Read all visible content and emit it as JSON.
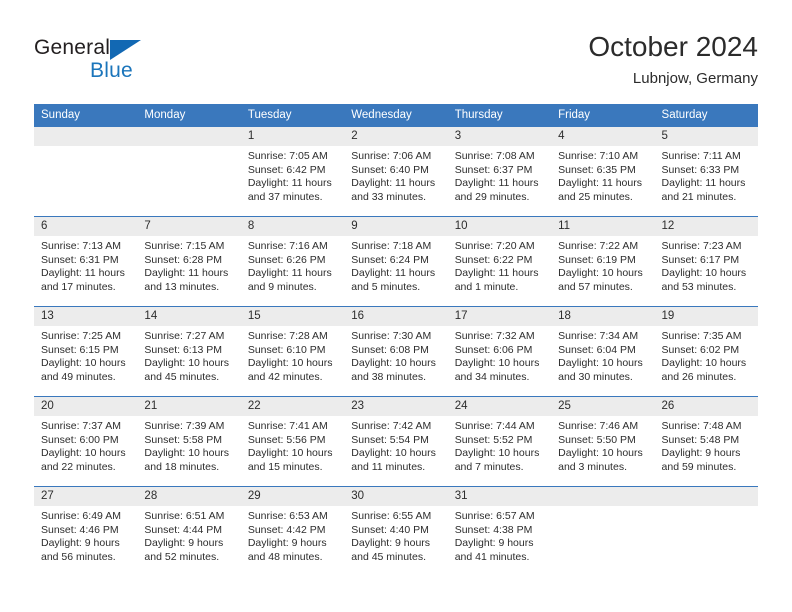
{
  "brand": {
    "name_top": "General",
    "name_bottom": "Blue",
    "triangle_color": "#1268b3",
    "blue_color": "#1b75bb"
  },
  "header": {
    "title": "October 2024",
    "subtitle": "Lubnjow, Germany"
  },
  "theme": {
    "header_blue": "#3a78bd",
    "daynum_band": "#ececec",
    "text": "#2d2d2d"
  },
  "weekdays": [
    "Sunday",
    "Monday",
    "Tuesday",
    "Wednesday",
    "Thursday",
    "Friday",
    "Saturday"
  ],
  "labels": {
    "sunrise": "Sunrise:",
    "sunset": "Sunset:",
    "daylight": "Daylight:"
  },
  "weeks": [
    [
      {
        "day": "",
        "sunrise": "",
        "sunset": "",
        "daylight_l1": "",
        "daylight_l2": ""
      },
      {
        "day": "",
        "sunrise": "",
        "sunset": "",
        "daylight_l1": "",
        "daylight_l2": ""
      },
      {
        "day": "1",
        "sunrise": "Sunrise: 7:05 AM",
        "sunset": "Sunset: 6:42 PM",
        "daylight_l1": "Daylight: 11 hours",
        "daylight_l2": "and 37 minutes."
      },
      {
        "day": "2",
        "sunrise": "Sunrise: 7:06 AM",
        "sunset": "Sunset: 6:40 PM",
        "daylight_l1": "Daylight: 11 hours",
        "daylight_l2": "and 33 minutes."
      },
      {
        "day": "3",
        "sunrise": "Sunrise: 7:08 AM",
        "sunset": "Sunset: 6:37 PM",
        "daylight_l1": "Daylight: 11 hours",
        "daylight_l2": "and 29 minutes."
      },
      {
        "day": "4",
        "sunrise": "Sunrise: 7:10 AM",
        "sunset": "Sunset: 6:35 PM",
        "daylight_l1": "Daylight: 11 hours",
        "daylight_l2": "and 25 minutes."
      },
      {
        "day": "5",
        "sunrise": "Sunrise: 7:11 AM",
        "sunset": "Sunset: 6:33 PM",
        "daylight_l1": "Daylight: 11 hours",
        "daylight_l2": "and 21 minutes."
      }
    ],
    [
      {
        "day": "6",
        "sunrise": "Sunrise: 7:13 AM",
        "sunset": "Sunset: 6:31 PM",
        "daylight_l1": "Daylight: 11 hours",
        "daylight_l2": "and 17 minutes."
      },
      {
        "day": "7",
        "sunrise": "Sunrise: 7:15 AM",
        "sunset": "Sunset: 6:28 PM",
        "daylight_l1": "Daylight: 11 hours",
        "daylight_l2": "and 13 minutes."
      },
      {
        "day": "8",
        "sunrise": "Sunrise: 7:16 AM",
        "sunset": "Sunset: 6:26 PM",
        "daylight_l1": "Daylight: 11 hours",
        "daylight_l2": "and 9 minutes."
      },
      {
        "day": "9",
        "sunrise": "Sunrise: 7:18 AM",
        "sunset": "Sunset: 6:24 PM",
        "daylight_l1": "Daylight: 11 hours",
        "daylight_l2": "and 5 minutes."
      },
      {
        "day": "10",
        "sunrise": "Sunrise: 7:20 AM",
        "sunset": "Sunset: 6:22 PM",
        "daylight_l1": "Daylight: 11 hours",
        "daylight_l2": "and 1 minute."
      },
      {
        "day": "11",
        "sunrise": "Sunrise: 7:22 AM",
        "sunset": "Sunset: 6:19 PM",
        "daylight_l1": "Daylight: 10 hours",
        "daylight_l2": "and 57 minutes."
      },
      {
        "day": "12",
        "sunrise": "Sunrise: 7:23 AM",
        "sunset": "Sunset: 6:17 PM",
        "daylight_l1": "Daylight: 10 hours",
        "daylight_l2": "and 53 minutes."
      }
    ],
    [
      {
        "day": "13",
        "sunrise": "Sunrise: 7:25 AM",
        "sunset": "Sunset: 6:15 PM",
        "daylight_l1": "Daylight: 10 hours",
        "daylight_l2": "and 49 minutes."
      },
      {
        "day": "14",
        "sunrise": "Sunrise: 7:27 AM",
        "sunset": "Sunset: 6:13 PM",
        "daylight_l1": "Daylight: 10 hours",
        "daylight_l2": "and 45 minutes."
      },
      {
        "day": "15",
        "sunrise": "Sunrise: 7:28 AM",
        "sunset": "Sunset: 6:10 PM",
        "daylight_l1": "Daylight: 10 hours",
        "daylight_l2": "and 42 minutes."
      },
      {
        "day": "16",
        "sunrise": "Sunrise: 7:30 AM",
        "sunset": "Sunset: 6:08 PM",
        "daylight_l1": "Daylight: 10 hours",
        "daylight_l2": "and 38 minutes."
      },
      {
        "day": "17",
        "sunrise": "Sunrise: 7:32 AM",
        "sunset": "Sunset: 6:06 PM",
        "daylight_l1": "Daylight: 10 hours",
        "daylight_l2": "and 34 minutes."
      },
      {
        "day": "18",
        "sunrise": "Sunrise: 7:34 AM",
        "sunset": "Sunset: 6:04 PM",
        "daylight_l1": "Daylight: 10 hours",
        "daylight_l2": "and 30 minutes."
      },
      {
        "day": "19",
        "sunrise": "Sunrise: 7:35 AM",
        "sunset": "Sunset: 6:02 PM",
        "daylight_l1": "Daylight: 10 hours",
        "daylight_l2": "and 26 minutes."
      }
    ],
    [
      {
        "day": "20",
        "sunrise": "Sunrise: 7:37 AM",
        "sunset": "Sunset: 6:00 PM",
        "daylight_l1": "Daylight: 10 hours",
        "daylight_l2": "and 22 minutes."
      },
      {
        "day": "21",
        "sunrise": "Sunrise: 7:39 AM",
        "sunset": "Sunset: 5:58 PM",
        "daylight_l1": "Daylight: 10 hours",
        "daylight_l2": "and 18 minutes."
      },
      {
        "day": "22",
        "sunrise": "Sunrise: 7:41 AM",
        "sunset": "Sunset: 5:56 PM",
        "daylight_l1": "Daylight: 10 hours",
        "daylight_l2": "and 15 minutes."
      },
      {
        "day": "23",
        "sunrise": "Sunrise: 7:42 AM",
        "sunset": "Sunset: 5:54 PM",
        "daylight_l1": "Daylight: 10 hours",
        "daylight_l2": "and 11 minutes."
      },
      {
        "day": "24",
        "sunrise": "Sunrise: 7:44 AM",
        "sunset": "Sunset: 5:52 PM",
        "daylight_l1": "Daylight: 10 hours",
        "daylight_l2": "and 7 minutes."
      },
      {
        "day": "25",
        "sunrise": "Sunrise: 7:46 AM",
        "sunset": "Sunset: 5:50 PM",
        "daylight_l1": "Daylight: 10 hours",
        "daylight_l2": "and 3 minutes."
      },
      {
        "day": "26",
        "sunrise": "Sunrise: 7:48 AM",
        "sunset": "Sunset: 5:48 PM",
        "daylight_l1": "Daylight: 9 hours",
        "daylight_l2": "and 59 minutes."
      }
    ],
    [
      {
        "day": "27",
        "sunrise": "Sunrise: 6:49 AM",
        "sunset": "Sunset: 4:46 PM",
        "daylight_l1": "Daylight: 9 hours",
        "daylight_l2": "and 56 minutes."
      },
      {
        "day": "28",
        "sunrise": "Sunrise: 6:51 AM",
        "sunset": "Sunset: 4:44 PM",
        "daylight_l1": "Daylight: 9 hours",
        "daylight_l2": "and 52 minutes."
      },
      {
        "day": "29",
        "sunrise": "Sunrise: 6:53 AM",
        "sunset": "Sunset: 4:42 PM",
        "daylight_l1": "Daylight: 9 hours",
        "daylight_l2": "and 48 minutes."
      },
      {
        "day": "30",
        "sunrise": "Sunrise: 6:55 AM",
        "sunset": "Sunset: 4:40 PM",
        "daylight_l1": "Daylight: 9 hours",
        "daylight_l2": "and 45 minutes."
      },
      {
        "day": "31",
        "sunrise": "Sunrise: 6:57 AM",
        "sunset": "Sunset: 4:38 PM",
        "daylight_l1": "Daylight: 9 hours",
        "daylight_l2": "and 41 minutes."
      },
      {
        "day": "",
        "sunrise": "",
        "sunset": "",
        "daylight_l1": "",
        "daylight_l2": ""
      },
      {
        "day": "",
        "sunrise": "",
        "sunset": "",
        "daylight_l1": "",
        "daylight_l2": ""
      }
    ]
  ]
}
